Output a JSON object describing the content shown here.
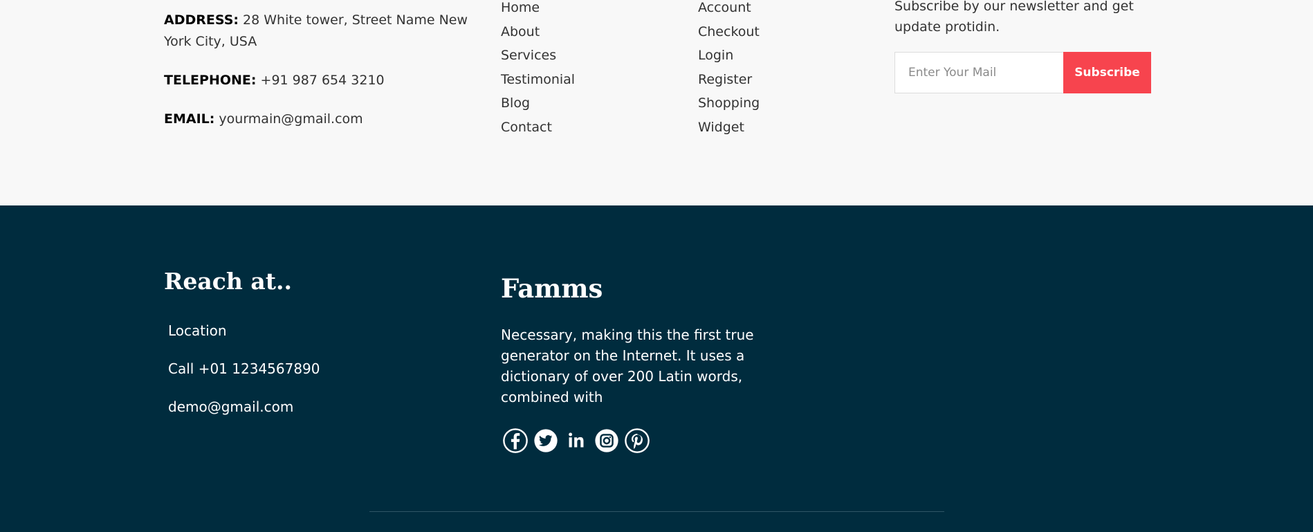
{
  "contact": {
    "address_label": "ADDRESS:",
    "address_value": " 28 White tower, Street Name New York City, USA",
    "telephone_label": "TELEPHONE:",
    "telephone_value": " +91 987 654 3210",
    "email_label": "EMAIL:",
    "email_value": " yourmain@gmail.com"
  },
  "links_col1": [
    "Home",
    "About",
    "Services",
    "Testimonial",
    "Blog",
    "Contact"
  ],
  "links_col2": [
    "Account",
    "Checkout",
    "Login",
    "Register",
    "Shopping",
    "Widget"
  ],
  "newsletter": {
    "text": "Subscribe by our newsletter and get update protidin.",
    "placeholder": "Enter Your Mail",
    "button": "Subscribe"
  },
  "reach": {
    "title": "Reach at..",
    "items": [
      "Location",
      "Call +01 1234567890",
      "demo@gmail.com"
    ]
  },
  "brand": {
    "title": "Famms",
    "description": "Necessary, making this the first true generator on the Internet. It uses a dictionary of over 200 Latin words, combined with",
    "socials": [
      "facebook-icon",
      "twitter-icon",
      "linkedin-icon",
      "instagram-icon",
      "pinterest-icon"
    ]
  },
  "colors": {
    "accent": "#f7444e",
    "footer_bg": "#002c3e",
    "top_bg": "#f8f8f8"
  }
}
